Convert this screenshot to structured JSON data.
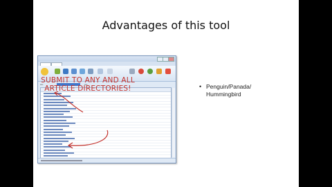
{
  "slide": {
    "title": "Advantages of this tool",
    "bullets": [
      {
        "text": "Penguin/Panada/\nHummingbird"
      }
    ]
  },
  "screenshot": {
    "overlay_text": "SUBMIT TO ANY AND ALL ARTICLE DIRECTORIES!",
    "row_count": 22,
    "colors": {
      "overlay_text": "#c4322c",
      "link_text": "#3b62a8",
      "window_border": "#7a96bd",
      "selection": "#3f74c9"
    }
  }
}
